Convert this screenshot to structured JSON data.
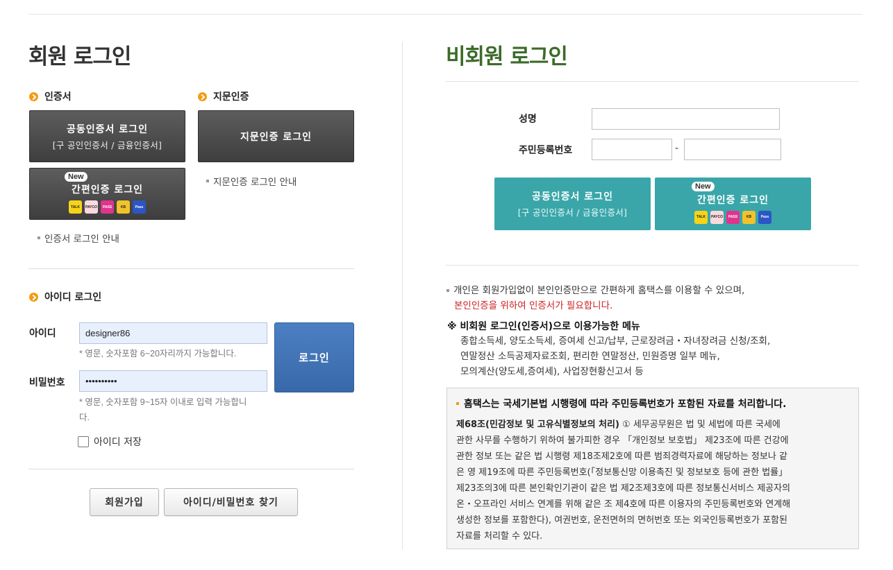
{
  "member_login": {
    "title": "회원 로그인",
    "cert_section": {
      "label": "인증서",
      "joint_cert_button": {
        "label": "공동인증서 로그인",
        "sub": "[구 공인인증서 / 금융인증서]"
      },
      "simple_auth_button": {
        "badge": "New",
        "label": "간편인증 로그인"
      },
      "guide_link": "인증서 로그인 안내"
    },
    "fingerprint_section": {
      "label": "지문인증",
      "button_label": "지문인증 로그인",
      "guide_link": "지문인증 로그인 안내"
    },
    "id_section": {
      "label": "아이디 로그인",
      "id_label": "아이디",
      "id_value": "designer86",
      "id_hint": "* 영문, 숫자포함 6~20자리까지 가능합니다.",
      "password_label": "비밀번호",
      "password_value": "••••••••••",
      "password_hint_line1": "* 영문, 숫자포함 9~15자 이내로 입력 가능합니",
      "password_hint_line2": "다.",
      "login_button": "로그인",
      "save_id_label": "아이디 저장",
      "save_id_checked": false
    },
    "signup_button": "회원가입",
    "find_account_button": "아이디/비밀번호 찾기"
  },
  "auth_icons": [
    {
      "name": "kakao-icon",
      "text": "TALK",
      "color": "#f7d417"
    },
    {
      "name": "payco-icon",
      "text": "PAYCO",
      "color": "#fadadd"
    },
    {
      "name": "pass-icon",
      "text": "PASS",
      "color": "#e0348c"
    },
    {
      "name": "kb-icon",
      "text": "KB",
      "color": "#f2c22b"
    },
    {
      "name": "samsung-pass-icon",
      "text": "Pass",
      "color": "#2c56c5"
    }
  ],
  "non_member_login": {
    "title": "비회원 로그인",
    "name_label": "성명",
    "name_value": "",
    "rrn_label": "주민등록번호",
    "rrn_first": "",
    "rrn_separator": "-",
    "rrn_second": "",
    "joint_cert_button": {
      "label": "공동인증서 로그인",
      "sub": "[구 공인인증서 / 금융인증서]"
    },
    "simple_auth_button": {
      "badge": "New",
      "label": "간편인증 로그인"
    },
    "notice_line1": "개인은 회원가입없이 본인인증만으로 간편하게 홈택스를 이용할 수 있으며,",
    "notice_line2_red": "본인인증을 위하여 인증서가 필요합니다.",
    "menu_title": "※ 비회원 로그인(인증서)으로 이용가능한 메뉴",
    "menu_lines": [
      "종합소득세, 양도소득세, 증여세 신고/납부, 근로장려금・자녀장려금 신청/조회,",
      "연말정산 소득공제자료조회, 편리한 연말정산, 민원증명 일부 메뉴,",
      "모의계산(양도세,증여세), 사업장현황신고서 등"
    ],
    "legal_box": {
      "heading": "홈택스는 국세기본법 시행령에 따라 주민등록번호가 포함된 자료를 처리합니다.",
      "article_title": "제68조(민감정보 및 고유식별정보의 처리)",
      "lines": [
        " ① 세무공무원은 법 및 세법에 따른 국세에",
        "관한 사무를 수행하기 위하여 불가피한 경우 「개인정보 보호법」 제23조에 따른 건강에",
        "관한 정보 또는 같은 법 시행령 제18조제2호에 따른 범죄경력자료에 해당하는 정보나 같",
        "은 영 제19조에 따른 주민등록번호(「정보통신망 이용촉진 및 정보보호 등에 관한 법률」",
        "제23조의3에 따른 본인확인기관이 같은 법 제2조제3호에 따른 정보통신서비스 제공자의",
        "온・오프라인 서비스 연계를 위해 같은 조 제4호에 따른 이용자의 주민등록번호와 연계해",
        "생성한 정보를 포함한다), 여권번호, 운전면허의 면허번호 또는 외국인등록번호가 포함된",
        "자료를 처리할 수 있다."
      ]
    }
  }
}
